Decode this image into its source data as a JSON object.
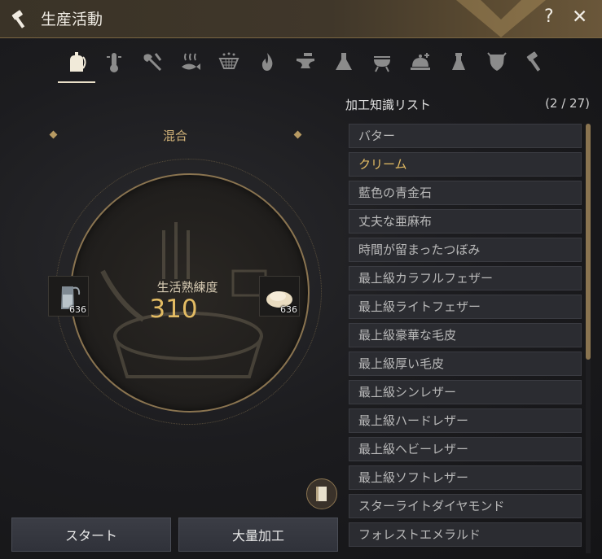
{
  "window": {
    "title": "生産活動",
    "help": "?",
    "close": "✕"
  },
  "tabs": [
    {
      "name": "tab-gathering",
      "icon": "hand-bottle-icon",
      "active": true
    },
    {
      "name": "tab-temperature",
      "icon": "thermometer-icon"
    },
    {
      "name": "tab-chopping",
      "icon": "axe-icon"
    },
    {
      "name": "tab-drying",
      "icon": "fish-heat-icon"
    },
    {
      "name": "tab-filtering",
      "icon": "sieve-icon"
    },
    {
      "name": "tab-heating",
      "icon": "flame-icon"
    },
    {
      "name": "tab-forging",
      "icon": "anvil-icon"
    },
    {
      "name": "tab-alchemy",
      "icon": "flask-icon"
    },
    {
      "name": "tab-grill",
      "icon": "grill-icon"
    },
    {
      "name": "tab-cooking",
      "icon": "cloche-icon"
    },
    {
      "name": "tab-alchemy-tools",
      "icon": "alchemy-tools-icon"
    },
    {
      "name": "tab-crest",
      "icon": "shield-crest-icon"
    },
    {
      "name": "tab-tools",
      "icon": "hammer-icon"
    }
  ],
  "process": {
    "category": "混合",
    "proficiency_label": "生活熟練度",
    "proficiency_value": "310",
    "left_slot": {
      "icon": "bottle-icon",
      "qty": "636"
    },
    "right_slot": {
      "icon": "flour-pile-icon",
      "qty": "636"
    }
  },
  "buttons": {
    "start": "スタート",
    "mass": "大量加工"
  },
  "knowledge": {
    "header": "加工知識リスト",
    "count": "(2 / 27)",
    "items": [
      "バター",
      "クリーム",
      "藍色の青金石",
      "丈夫な亜麻布",
      "時間が留まったつぼみ",
      "最上級カラフルフェザー",
      "最上級ライトフェザー",
      "最上級豪華な毛皮",
      "最上級厚い毛皮",
      "最上級シンレザー",
      "最上級ハードレザー",
      "最上級ヘビーレザー",
      "最上級ソフトレザー",
      "スターライトダイヤモンド",
      "フォレストエメラルド"
    ],
    "selected_index": 1
  },
  "colors": {
    "accent_gold": "#e2bb63",
    "title_bar": "#40372a"
  }
}
